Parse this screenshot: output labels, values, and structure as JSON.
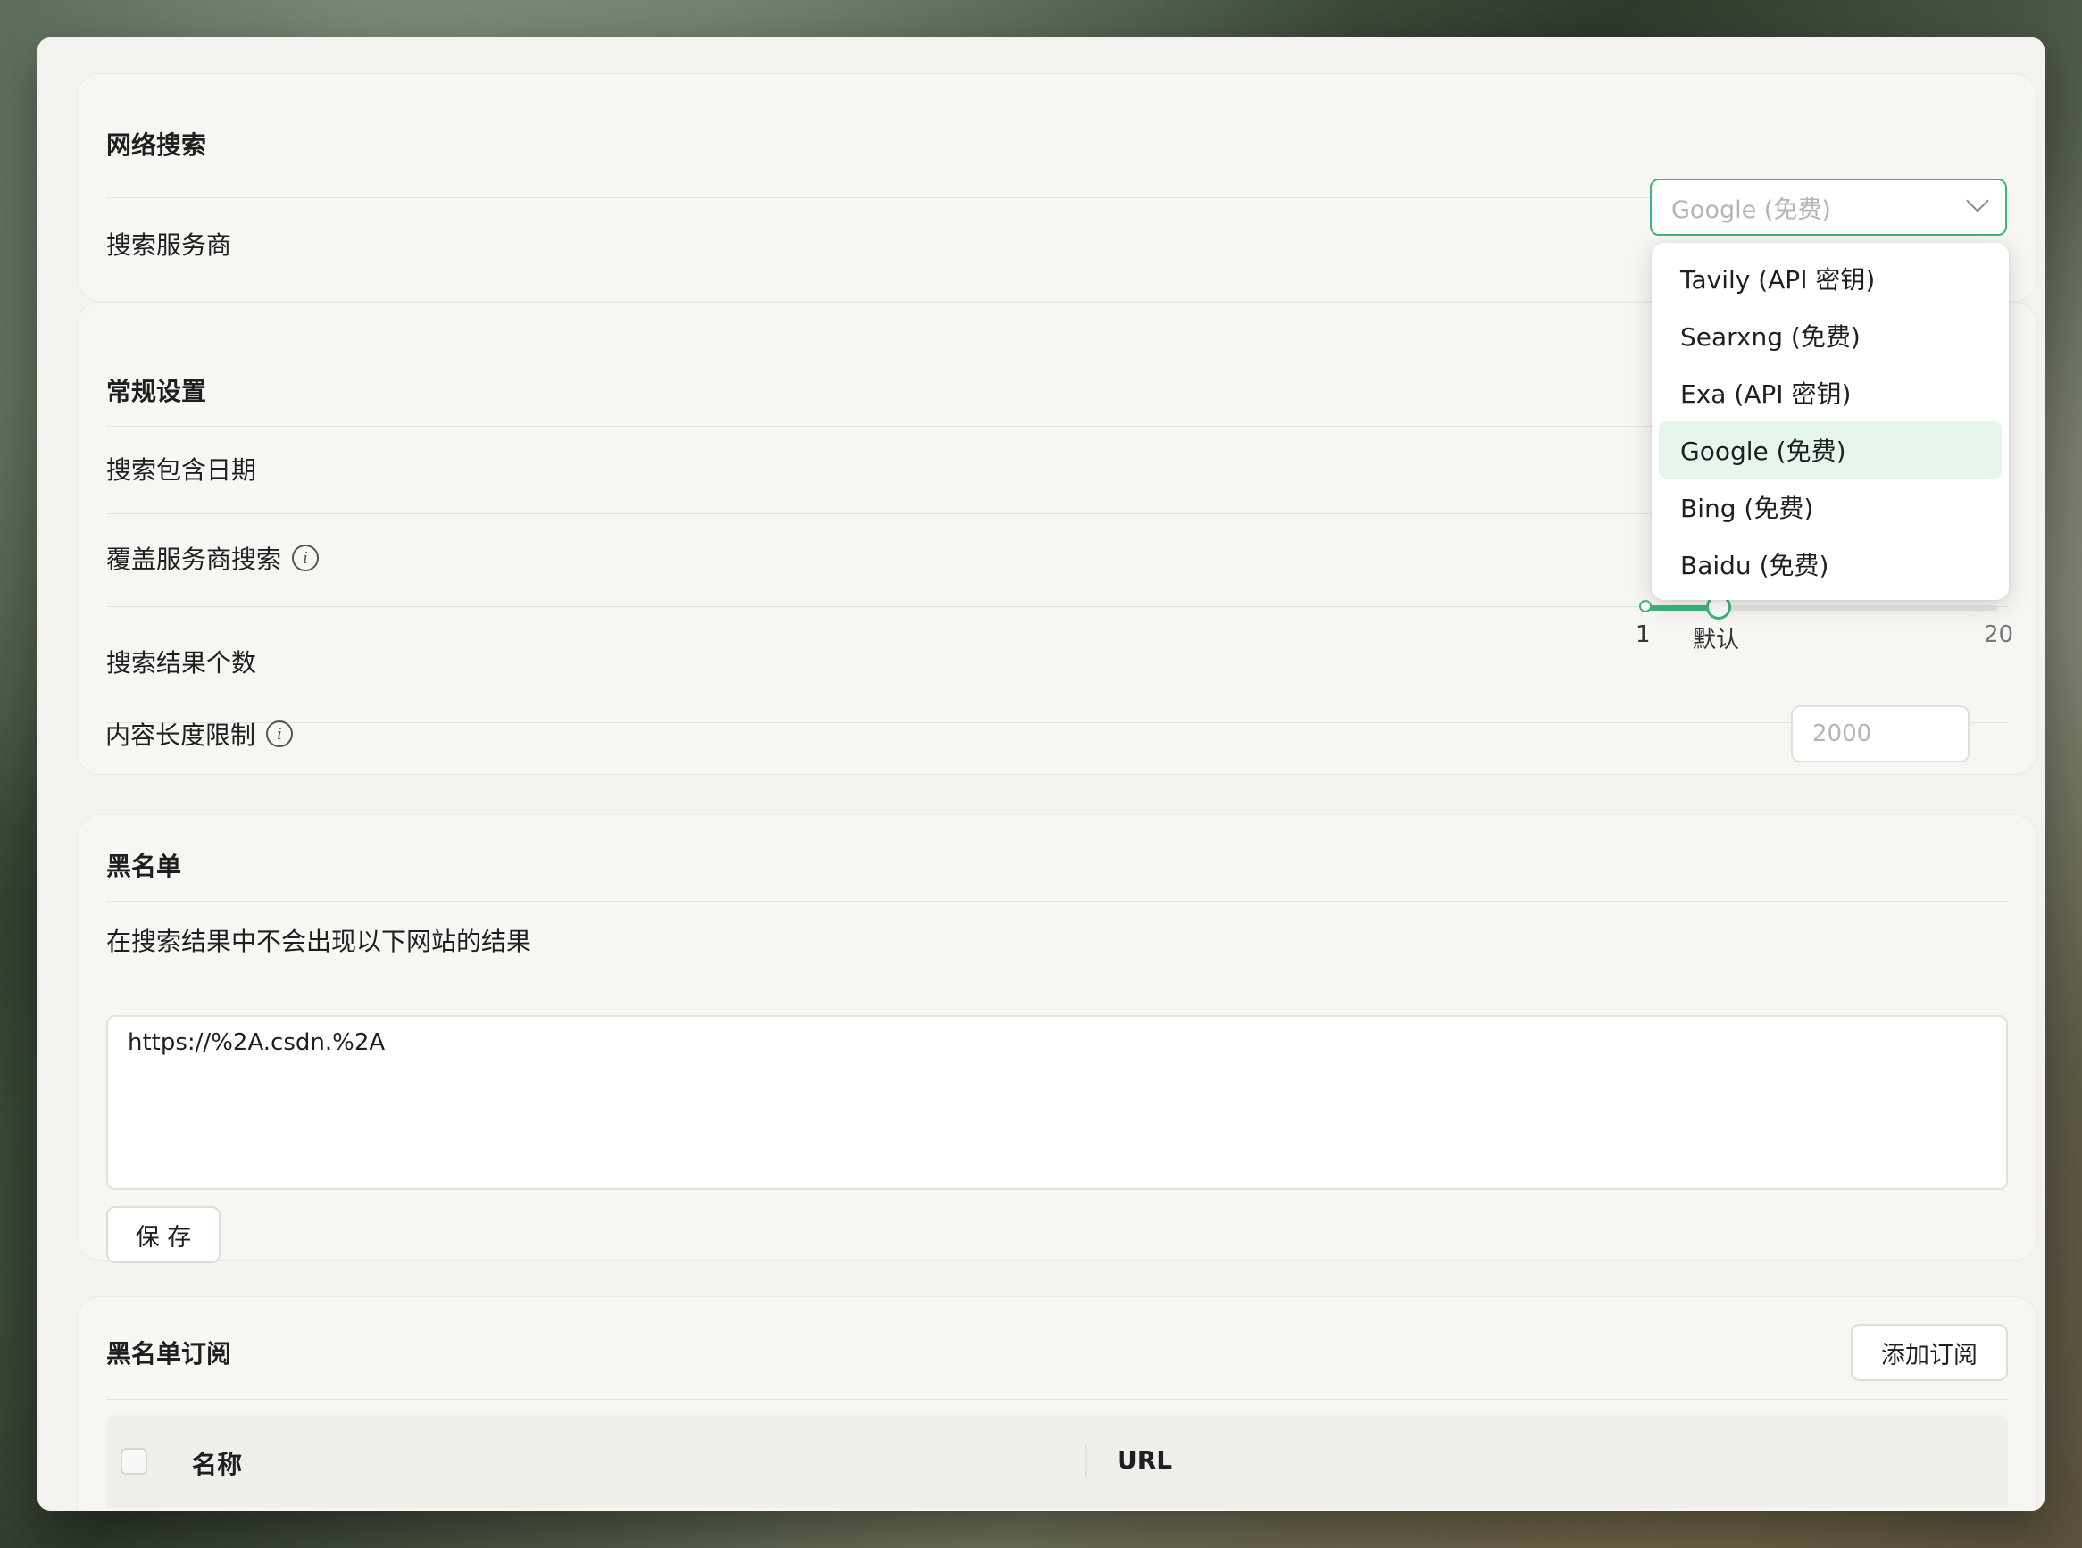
{
  "web_search": {
    "title": "网络搜索",
    "provider_label": "搜索服务商",
    "provider_selected": "Google (免费)",
    "provider_options": [
      {
        "label": "Tavily (API 密钥)"
      },
      {
        "label": "Searxng (免费)"
      },
      {
        "label": "Exa (API 密钥)"
      },
      {
        "label": "Google (免费)",
        "selected": true
      },
      {
        "label": "Bing (免费)"
      },
      {
        "label": "Baidu (免费)"
      }
    ]
  },
  "general": {
    "title": "常规设置",
    "include_date_label": "搜索包含日期",
    "override_label": "覆盖服务商搜索",
    "result_count_label": "搜索结果个数",
    "slider": {
      "min_label": "1",
      "default_label": "默认",
      "max_label": "20",
      "min": 1,
      "max": 20,
      "value": 5
    },
    "content_limit_label": "内容长度限制",
    "content_limit_placeholder": "2000"
  },
  "blacklist": {
    "title": "黑名单",
    "description": "在搜索结果中不会出现以下网站的结果",
    "textarea_value": "https://%2A.csdn.%2A",
    "save_label": "保 存"
  },
  "subscriptions": {
    "title": "黑名单订阅",
    "add_label": "添加订阅",
    "columns": [
      "名称",
      "URL"
    ]
  },
  "colors": {
    "accent": "#3fb57d",
    "selected_bg": "#e5f6ec"
  }
}
